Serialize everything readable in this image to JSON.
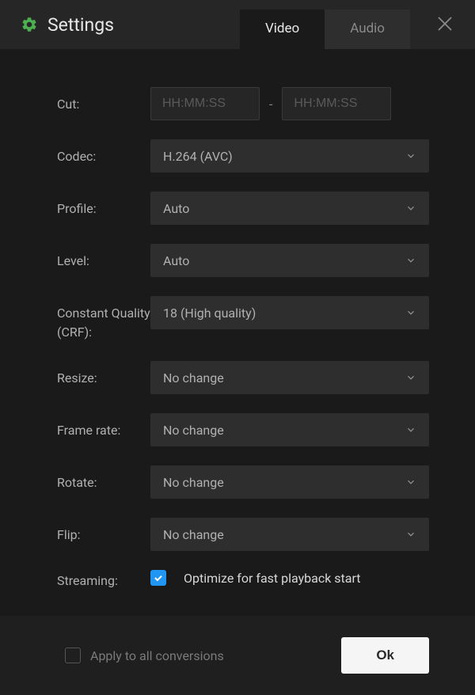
{
  "header": {
    "title": "Settings",
    "tabs": {
      "video": "Video",
      "audio": "Audio"
    }
  },
  "fields": {
    "cut": {
      "label": "Cut:",
      "placeholder_start": "HH:MM:SS",
      "placeholder_end": "HH:MM:SS",
      "dash": "-"
    },
    "codec": {
      "label": "Codec:",
      "value": "H.264 (AVC)"
    },
    "profile": {
      "label": "Profile:",
      "value": "Auto"
    },
    "level": {
      "label": "Level:",
      "value": "Auto"
    },
    "crf": {
      "label": "Constant Quality (CRF):",
      "value": "18 (High quality)"
    },
    "resize": {
      "label": "Resize:",
      "value": "No change"
    },
    "framerate": {
      "label": "Frame rate:",
      "value": "No change"
    },
    "rotate": {
      "label": "Rotate:",
      "value": "No change"
    },
    "flip": {
      "label": "Flip:",
      "value": "No change"
    },
    "streaming": {
      "label": "Streaming:",
      "checkbox_label": "Optimize for fast playback start",
      "checked": true
    }
  },
  "footer": {
    "apply_all": "Apply to all conversions",
    "ok": "Ok"
  }
}
